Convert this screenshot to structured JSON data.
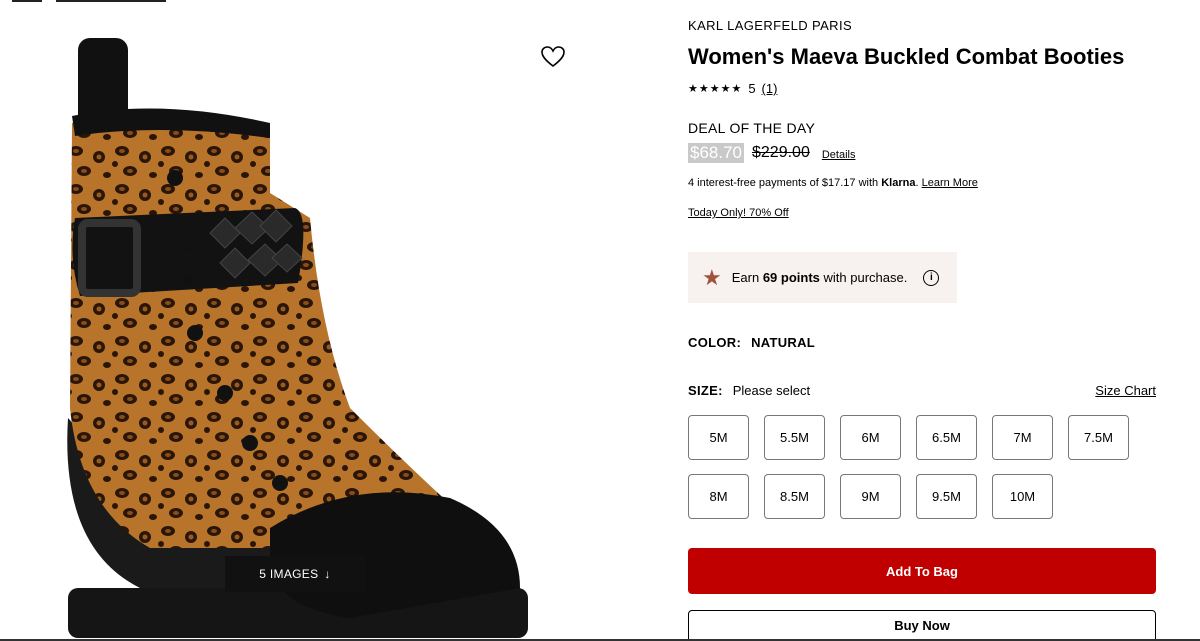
{
  "product": {
    "brand": "KARL LAGERFELD PARIS",
    "title": "Women's Maeva Buckled Combat Booties",
    "rating_stars": "★★★★★",
    "rating_value": "5",
    "review_count": "(1)",
    "deal_label": "DEAL OF THE DAY",
    "sale_price": "$68.70",
    "original_price": "$229.00",
    "details_link": "Details",
    "klarna_prefix": "4 interest-free payments of $17.17 with ",
    "klarna_brand": "Klarna",
    "klarna_suffix": ". ",
    "klarna_learn_more": "Learn More",
    "promo": "Today Only! 70% Off"
  },
  "points": {
    "prefix": "Earn ",
    "value": "69 points",
    "suffix": " with purchase.",
    "icon": "star-icon",
    "star_color": "#a0523d"
  },
  "color": {
    "label": "COLOR:",
    "value": "NATURAL"
  },
  "size": {
    "label": "SIZE:",
    "value": "Please select",
    "chart_link": "Size Chart",
    "options": [
      "5M",
      "5.5M",
      "6M",
      "6.5M",
      "7M",
      "7.5M",
      "8M",
      "8.5M",
      "9M",
      "9.5M",
      "10M"
    ]
  },
  "gallery": {
    "images_button": "5 IMAGES",
    "images_icon": "arrow-down-icon"
  },
  "actions": {
    "add_to_bag": "Add To Bag",
    "buy_now": "Buy Now",
    "add_color": "#c00000"
  }
}
